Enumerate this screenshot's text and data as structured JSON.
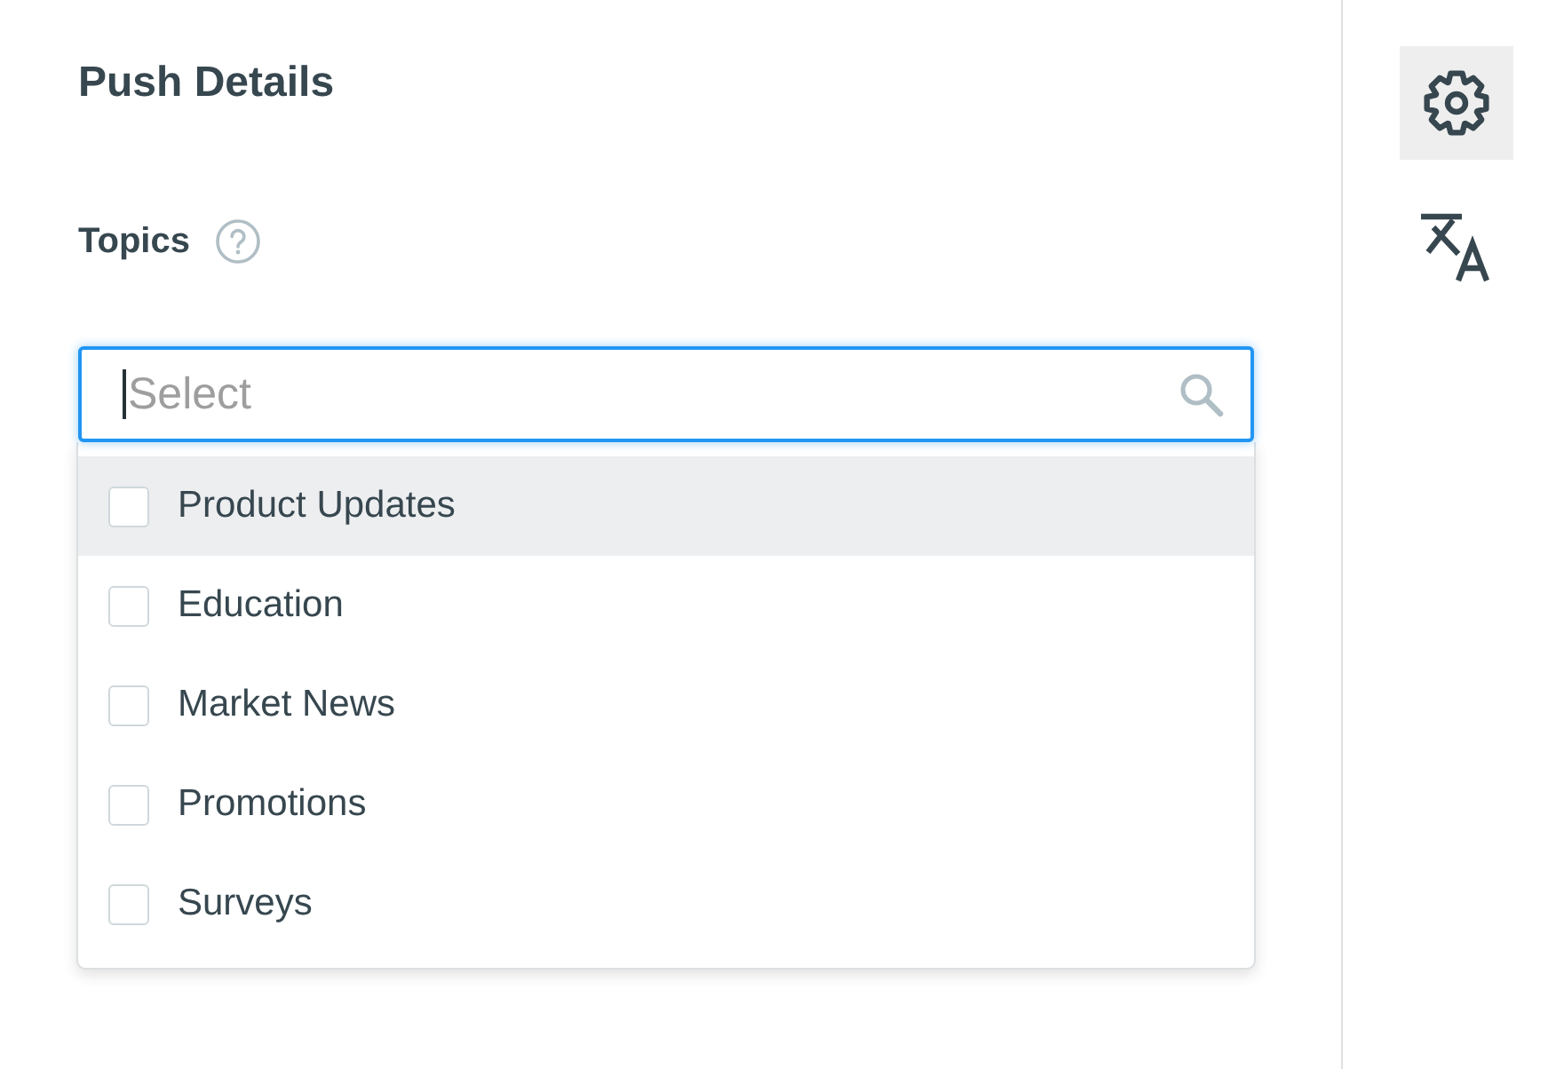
{
  "panel": {
    "title": "Push Details",
    "field_label": "Topics"
  },
  "search": {
    "placeholder": "Select",
    "focused": true
  },
  "options": [
    {
      "label": "Product Updates",
      "checked": false,
      "highlighted": true
    },
    {
      "label": "Education",
      "checked": false,
      "highlighted": false
    },
    {
      "label": "Market News",
      "checked": false,
      "highlighted": false
    },
    {
      "label": "Promotions",
      "checked": false,
      "highlighted": false
    },
    {
      "label": "Surveys",
      "checked": false,
      "highlighted": false
    }
  ],
  "rail_buttons": [
    {
      "kind": "settings",
      "selected": true
    },
    {
      "kind": "translate",
      "selected": false
    }
  ]
}
